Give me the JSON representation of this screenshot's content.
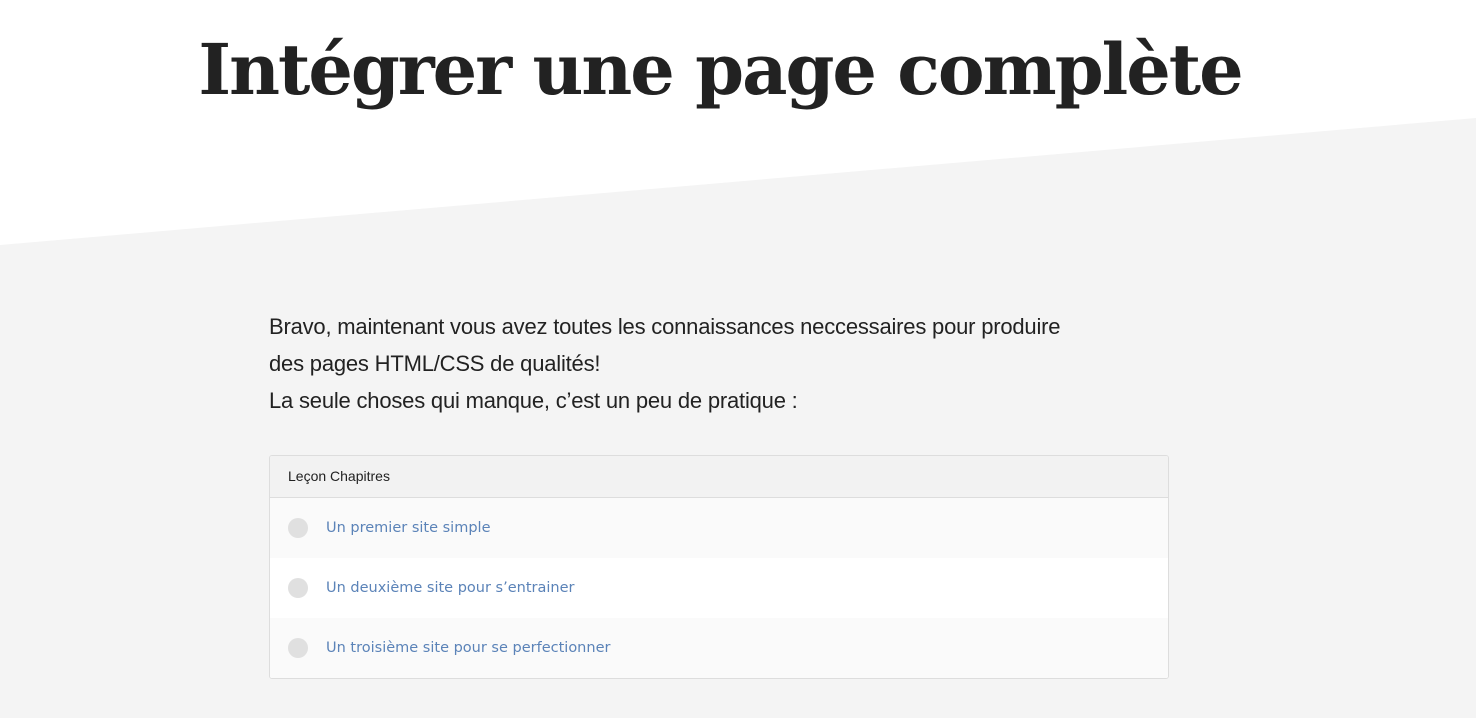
{
  "page": {
    "title": "Intégrer une page complète"
  },
  "intro": {
    "lines": [
      "Bravo, maintenant vous avez toutes les connaissances neccessaires pour produire",
      "des pages HTML/CSS de qualités!",
      "La seule choses qui manque, c’est un peu de pratique :"
    ]
  },
  "chapters": {
    "header": "Leçon Chapitres",
    "items": [
      {
        "label": "Un premier site simple",
        "icon": "circle-status-icon"
      },
      {
        "label": "Un deuxième site pour s’entrainer",
        "icon": "circle-status-icon"
      },
      {
        "label": "Un troisième site pour se perfectionner",
        "icon": "circle-status-icon"
      }
    ],
    "link_color": "#5b83b8"
  }
}
